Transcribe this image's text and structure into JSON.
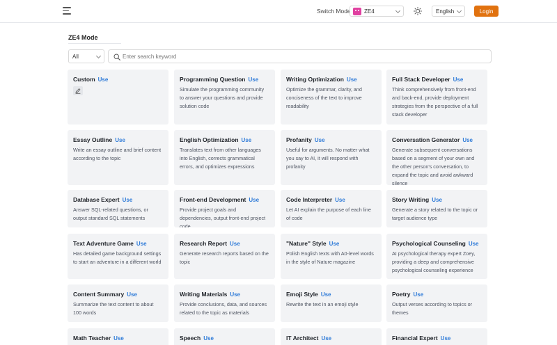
{
  "header": {
    "switch_label": "Switch Mode",
    "mode_value": "ZE4",
    "language_value": "English",
    "login_label": "Login"
  },
  "page_title": "ZE4 Mode",
  "filter": {
    "category_value": "All",
    "search_placeholder": "Enter search keyword"
  },
  "use_label": "Use",
  "cards": [
    {
      "title": "Custom",
      "desc": ""
    },
    {
      "title": "Programming Question",
      "desc": "Simulate the programming community to answer your questions and provide solution code"
    },
    {
      "title": "Writing Optimization",
      "desc": "Optimize the grammar, clarity, and conciseness of the text to improve readability"
    },
    {
      "title": "Full Stack Developer",
      "desc": "Think comprehensively from front-end and back-end, provide deployment strategies from the perspective of a full stack developer"
    },
    {
      "title": "Essay Outline",
      "desc": "Write an essay outline and brief content according to the topic"
    },
    {
      "title": "English Optimization",
      "desc": "Translates text from other languages into English, corrects grammatical errors, and optimizes expressions"
    },
    {
      "title": "Profanity",
      "desc": "Useful for arguments. No matter what you say to AI, it will respond with profanity"
    },
    {
      "title": "Conversation Generator",
      "desc": "Generate subsequent conversations based on a segment of your own and the other person's conversation, to expand the topic and avoid awkward silence"
    },
    {
      "title": "Database Expert",
      "desc": "Answer SQL-related questions, or output standard SQL statements"
    },
    {
      "title": "Front-end Development",
      "desc": "Provide project goals and dependencies, output front-end project code"
    },
    {
      "title": "Code Interpreter",
      "desc": "Let AI explain the purpose of each line of code"
    },
    {
      "title": "Story Writing",
      "desc": "Generate a story related to the topic or target audience type"
    },
    {
      "title": "Text Adventure Game",
      "desc": "Has detailed game background settings to start an adventure in a different world"
    },
    {
      "title": "Research Report",
      "desc": "Generate research reports based on the topic"
    },
    {
      "title": "\"Nature\" Style",
      "desc": "Polish English texts with A0-level words in the style of Nature magazine"
    },
    {
      "title": "Psychological Counseling",
      "desc": "AI psychological therapy expert Zoey, providing a deep and comprehensive psychological counseling experience"
    },
    {
      "title": "Content Summary",
      "desc": "Summarize the text content to about 100 words"
    },
    {
      "title": "Writing Materials",
      "desc": "Provide conclusions, data, and sources related to the topic as materials"
    },
    {
      "title": "Emoji Style",
      "desc": "Rewrite the text in an emoji style"
    },
    {
      "title": "Poetry",
      "desc": "Output verses according to topics or themes"
    },
    {
      "title": "Math Teacher",
      "desc": ""
    },
    {
      "title": "Speech",
      "desc": ""
    },
    {
      "title": "IT Architect",
      "desc": ""
    },
    {
      "title": "Financial Expert",
      "desc": ""
    }
  ]
}
